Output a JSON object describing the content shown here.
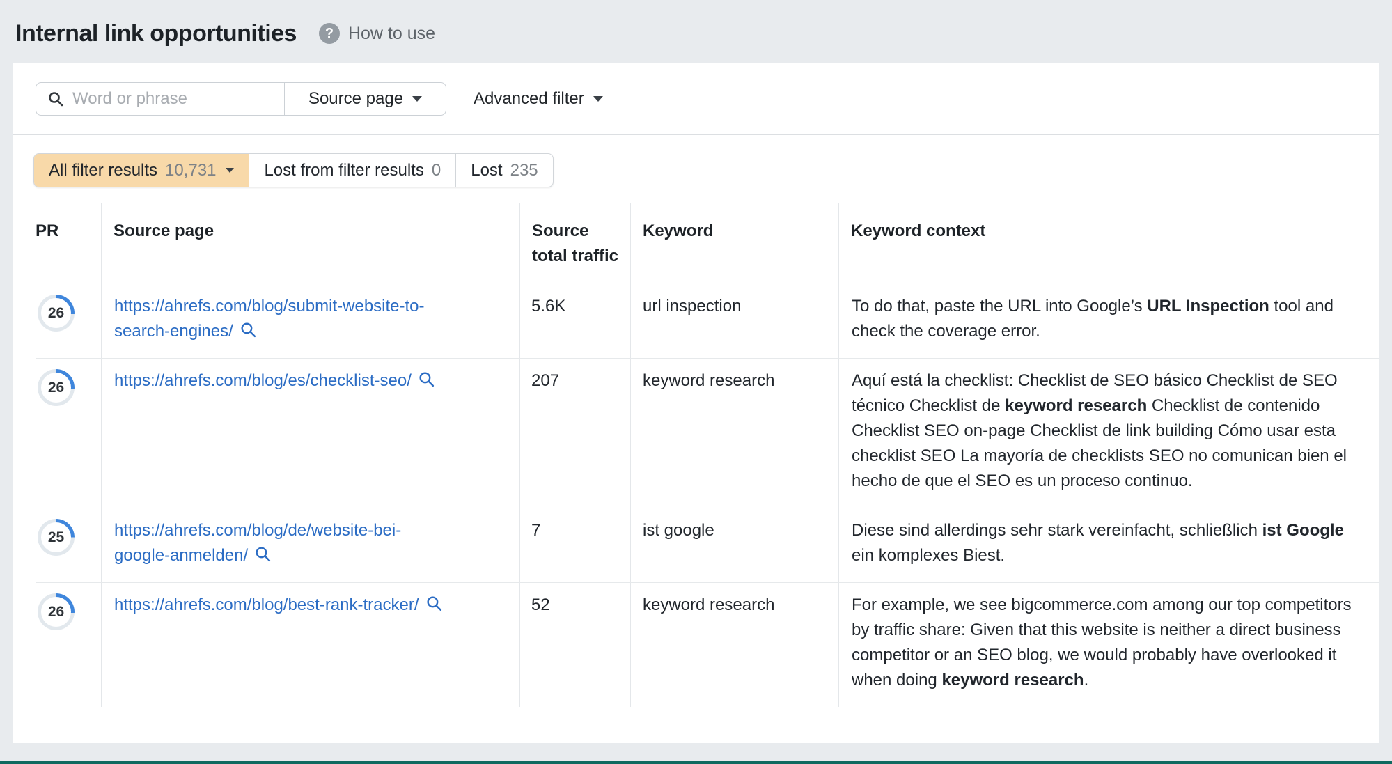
{
  "header": {
    "title": "Internal link opportunities",
    "help_label": "How to use"
  },
  "filter_bar": {
    "search_placeholder": "Word or phrase",
    "search_value": "",
    "scope_selected": "Source page",
    "advanced_filter_label": "Advanced filter"
  },
  "result_tabs": [
    {
      "label": "All filter results",
      "count": "10,731",
      "active": true
    },
    {
      "label": "Lost from filter results",
      "count": "0",
      "active": false
    },
    {
      "label": "Lost",
      "count": "235",
      "active": false
    }
  ],
  "table": {
    "columns": [
      "PR",
      "Source page",
      "Source total traffic",
      "Keyword",
      "Keyword context"
    ],
    "rows": [
      {
        "pr": "26",
        "pr_percent": 26,
        "url": "https://ahrefs.com/blog/submit-website-to-search-engines/",
        "traffic": "5.6K",
        "keyword": "url inspection",
        "context": {
          "pre": "To do that, paste the URL into Google’s ",
          "bold": "URL Inspection",
          "post": " tool and check the coverage error."
        }
      },
      {
        "pr": "26",
        "pr_percent": 26,
        "url": "https://ahrefs.com/blog/es/checklist-seo/",
        "traffic": "207",
        "keyword": "keyword research",
        "context": {
          "pre": "Aquí está la checklist: Checklist de SEO básico Checklist de SEO técnico Checklist de ",
          "bold": "keyword research",
          "post": " Checklist de contenido Checklist SEO on-page Checklist de link building Cómo usar esta checklist SEO La mayoría de checklists SEO no comunican bien el hecho de que el SEO es un proceso continuo."
        }
      },
      {
        "pr": "25",
        "pr_percent": 25,
        "url": "https://ahrefs.com/blog/de/website-bei-google-anmelden/",
        "traffic": "7",
        "keyword": "ist google",
        "context": {
          "pre": "Diese sind allerdings sehr stark vereinfacht, schließlich ",
          "bold": "ist Google",
          "post": " ein komplexes Biest."
        }
      },
      {
        "pr": "26",
        "pr_percent": 26,
        "url": "https://ahrefs.com/blog/best-rank-tracker/",
        "traffic": "52",
        "keyword": "keyword research",
        "context": {
          "pre": "For example, we see bigcommerce.com among our top competitors by traffic share: Given that this website is neither a direct business competitor or an SEO blog, we would probably have overlooked it when doing ",
          "bold": "keyword research",
          "post": "."
        }
      }
    ]
  },
  "icons": {
    "help": "question-circle-icon",
    "search": "magnifier-icon",
    "scope_caret": "caret-down-icon",
    "advanced_caret": "caret-down-icon",
    "tab_caret": "caret-down-icon",
    "url_inspect": "magnifier-icon"
  },
  "colors": {
    "ring_blue": "#3f86dc",
    "ring_track": "#e2e8ed",
    "link_blue": "#2b6cc4",
    "active_tab_bg": "#f8d9a9",
    "page_bg": "#e8ebee",
    "bottom_strip": "#0f6a60"
  }
}
